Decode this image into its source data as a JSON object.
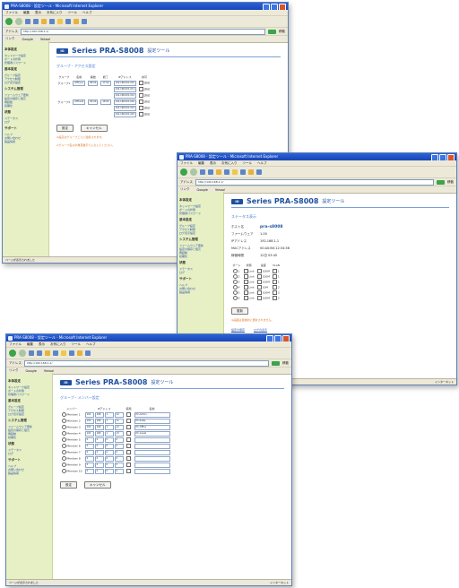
{
  "browser": {
    "title": "PRA-S8008 - 設定ツール - Microsoft Internet Explorer",
    "menu": [
      "ファイル",
      "編集",
      "表示",
      "お気に入り",
      "ツール",
      "ヘルプ"
    ],
    "address_label": "アドレス",
    "address": "http://192.168.1.1/",
    "go_label": "移動",
    "links": [
      "リンク",
      "Google",
      "Yahoo!"
    ],
    "status_left": "ページが表示されました",
    "status_right": "インターネット"
  },
  "app": {
    "logo": "IO",
    "product": "Series PRA-S8008",
    "tool": "設定ツール"
  },
  "sidebar": {
    "sections": [
      {
        "title": "本体設定",
        "links": [
          "ネットワーク設定",
          "ポートの状態",
          "管理者パスワード"
        ]
      },
      {
        "title": "基本設定",
        "links": [
          "グループ設定",
          "アクセス制限",
          "ログ表示設定"
        ]
      },
      {
        "title": "システム管理",
        "links": [
          "ファームウェア更新",
          "設定の保存と復元",
          "再起動",
          "初期化"
        ]
      },
      {
        "title": "状態",
        "links": [
          "ステータス",
          "ログ"
        ]
      },
      {
        "title": "サポート",
        "links": [
          "ヘルプ",
          "お問い合わせ",
          "製品情報"
        ]
      }
    ]
  },
  "window1": {
    "section_title": "グループ・アクセス設定",
    "headers": [
      "グループ",
      "名前",
      "開始",
      "終了",
      "IPアドレス",
      "許可"
    ],
    "rows": [
      {
        "group": "グループ1",
        "name": "Office-A",
        "start": "08:00",
        "end": "17:00",
        "ip": "192.168.001.010",
        "allow": "許可"
      },
      {
        "group": "",
        "name": "",
        "start": "",
        "end": "",
        "ip": "192.168.001.011",
        "allow": "許可"
      },
      {
        "group": "",
        "name": "",
        "start": "",
        "end": "",
        "ip": "192.168.001.012",
        "allow": "許可"
      },
      {
        "group": "グループ2",
        "name": "Office-B",
        "start": "09:00",
        "end": "18:00",
        "ip": "192.168.001.020",
        "allow": "許可"
      },
      {
        "group": "",
        "name": "",
        "start": "",
        "end": "",
        "ip": "192.168.001.021",
        "allow": "許可"
      },
      {
        "group": "",
        "name": "",
        "start": "",
        "end": "",
        "ip": "192.168.001.022",
        "allow": "許可"
      }
    ],
    "buttons": [
      "設定",
      "キャンセル"
    ],
    "notes": [
      "※設定はグループごとに適用されます。",
      "※グループ名は半角英数字で入力してください。"
    ]
  },
  "window2": {
    "section_title": "ステータス表示",
    "info": [
      {
        "key": "ホスト名",
        "value": "pra-s8008"
      },
      {
        "key": "ファームウェア",
        "value": "1.00"
      },
      {
        "key": "IPアドレス",
        "value": "192.168.1.1"
      },
      {
        "key": "MACアドレス",
        "value": "00:A0:B0:12:34:56"
      },
      {
        "key": "稼働時間",
        "value": "12日 03:45"
      }
    ],
    "port_headers": [
      "ポート",
      "状態",
      "速度",
      "VLAN"
    ],
    "ports": [
      {
        "port": "1",
        "status": "Link",
        "speed": "100M",
        "vlan": "1"
      },
      {
        "port": "2",
        "status": "Link",
        "speed": "100M",
        "vlan": "1"
      },
      {
        "port": "3",
        "status": "Link",
        "speed": "100M",
        "vlan": "1"
      },
      {
        "port": "4",
        "status": "Link",
        "speed": "10M",
        "vlan": "2"
      },
      {
        "port": "5",
        "status": "Link",
        "speed": "100M",
        "vlan": "2"
      },
      {
        "port": "6",
        "status": "Link",
        "speed": "100M",
        "vlan": "2"
      }
    ],
    "buttons": [
      "更新"
    ],
    "notes": [
      "※画面は自動的に更新されません。"
    ],
    "links": [
      "設定の保存",
      "ログの表示"
    ]
  },
  "window3": {
    "section_title": "グループ・メンバー設定",
    "headers": [
      "メンバー",
      "IPアドレス",
      "使用",
      "名前"
    ],
    "rows": [
      {
        "member": "Member 1",
        "ip": [
          "192",
          "168",
          "1",
          "10"
        ],
        "use": true,
        "name": "PC-Admin"
      },
      {
        "member": "Member 2",
        "ip": [
          "192",
          "168",
          "1",
          "11"
        ],
        "use": true,
        "name": "PC-Sales"
      },
      {
        "member": "Member 3",
        "ip": [
          "192",
          "168",
          "1",
          "12"
        ],
        "use": true,
        "name": "PC-Office"
      },
      {
        "member": "Member 4",
        "ip": [
          "192",
          "168",
          "1",
          "13"
        ],
        "use": true,
        "name": "PC-Guest"
      },
      {
        "member": "Member 5",
        "ip": [
          "0",
          "0",
          "0",
          "0"
        ],
        "use": false,
        "name": ""
      },
      {
        "member": "Member 6",
        "ip": [
          "0",
          "0",
          "0",
          "0"
        ],
        "use": false,
        "name": ""
      },
      {
        "member": "Member 7",
        "ip": [
          "0",
          "0",
          "0",
          "0"
        ],
        "use": false,
        "name": ""
      },
      {
        "member": "Member 8",
        "ip": [
          "0",
          "0",
          "0",
          "0"
        ],
        "use": false,
        "name": ""
      },
      {
        "member": "Member 9",
        "ip": [
          "0",
          "0",
          "0",
          "0"
        ],
        "use": false,
        "name": ""
      },
      {
        "member": "Member 10",
        "ip": [
          "0",
          "0",
          "0",
          "0"
        ],
        "use": false,
        "name": ""
      }
    ],
    "buttons": [
      "設定",
      "キャンセル"
    ]
  }
}
